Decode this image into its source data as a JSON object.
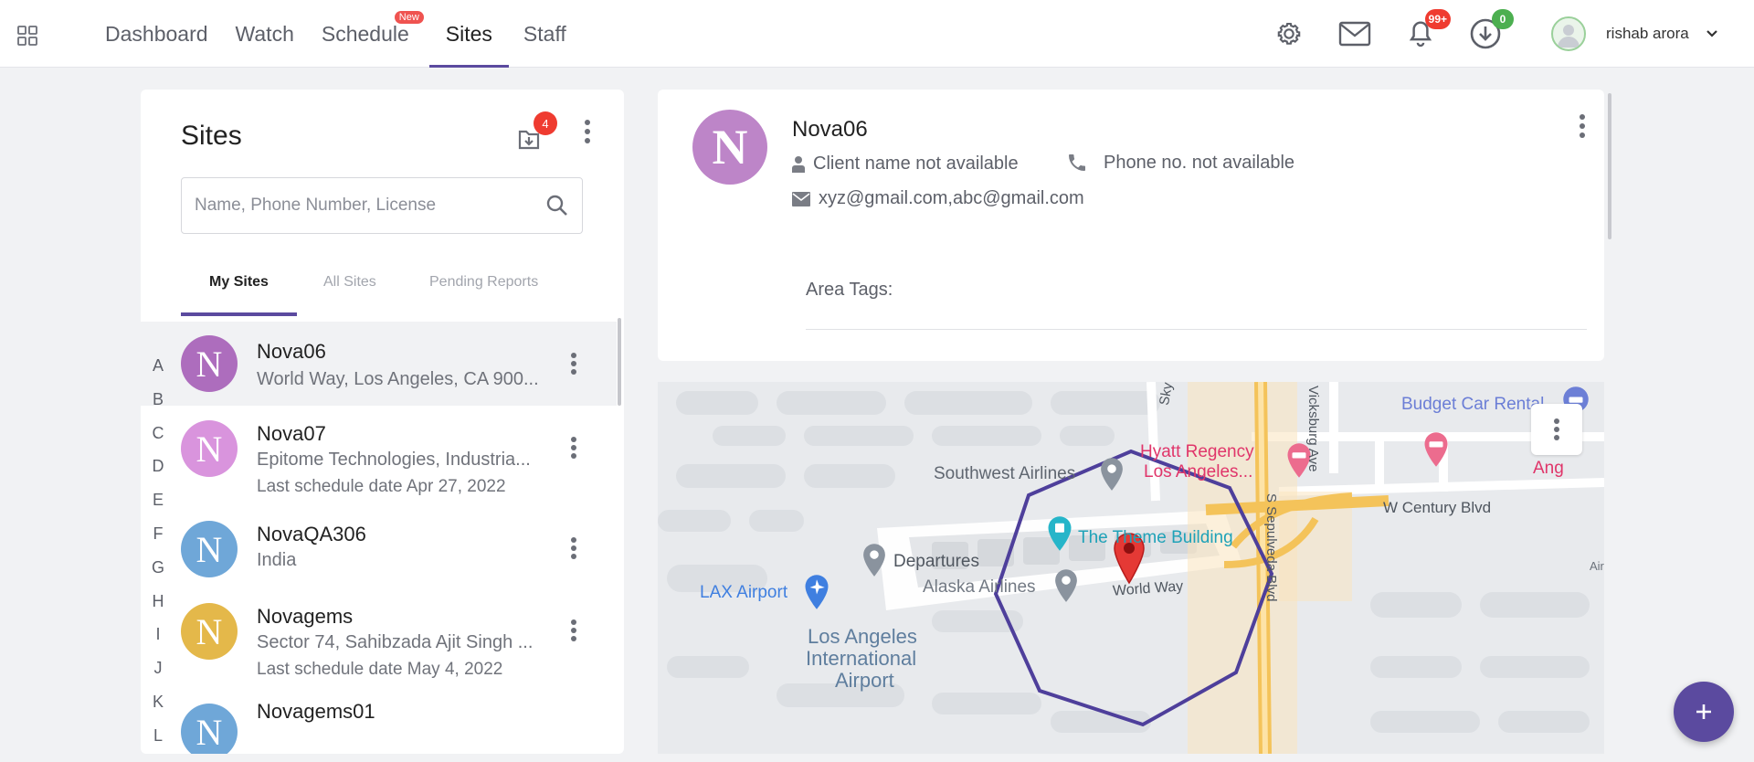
{
  "nav": {
    "tabs": [
      {
        "label": "Dashboard"
      },
      {
        "label": "Watch"
      },
      {
        "label": "Schedule",
        "badge": "New"
      },
      {
        "label": "Sites",
        "active": true
      },
      {
        "label": "Staff"
      }
    ],
    "icons": [
      "gear-icon",
      "mail-icon",
      "bell-icon",
      "download-icon"
    ],
    "notifications_count": "99+",
    "downloads_count": "0",
    "user_name": "rishab arora"
  },
  "sites_panel": {
    "title": "Sites",
    "import_count": "4",
    "search_placeholder": "Name, Phone Number, License",
    "tabs": [
      "My Sites",
      "All Sites",
      "Pending Reports"
    ],
    "active_tab": "My Sites",
    "alphabet": [
      "A",
      "B",
      "C",
      "D",
      "E",
      "F",
      "G",
      "H",
      "I",
      "J",
      "K",
      "L"
    ],
    "sites": [
      {
        "initial": "N",
        "name": "Nova06",
        "address": "World Way, Los Angeles, CA 900...",
        "last_schedule": "",
        "color": "#ad6dbd",
        "selected": true
      },
      {
        "initial": "N",
        "name": "Nova07",
        "address": "Epitome Technologies, Industria...",
        "last_schedule": "Last schedule date Apr 27, 2022",
        "color": "#d994dd",
        "selected": false
      },
      {
        "initial": "N",
        "name": "NovaQA306",
        "address": "India",
        "last_schedule": "",
        "color": "#6fa7d8",
        "selected": false
      },
      {
        "initial": "N",
        "name": "Novagems",
        "address": "Sector 74, Sahibzada Ajit Singh ...",
        "last_schedule": "Last schedule date May 4, 2022",
        "color": "#e4b84a",
        "selected": false
      },
      {
        "initial": "N",
        "name": "Novagems01",
        "address": "",
        "last_schedule": "",
        "color": "#6fa7d8",
        "selected": false
      }
    ]
  },
  "detail": {
    "initial": "N",
    "name": "Nova06",
    "client": "Client name not available",
    "phone": "Phone no. not available",
    "email": "xyz@gmail.com,abc@gmail.com",
    "area_tags_label": "Area Tags:"
  },
  "map": {
    "labels": {
      "budget": "Budget Car Rental",
      "hyatt_1": "Hyatt Regency",
      "hyatt_2": "Los Angeles...",
      "southwest": "Southwest Airlines",
      "theme": "The Theme Building",
      "departures": "Departures",
      "alaska": "Alaska Airlines",
      "world_way": "World Way",
      "lax": "LAX Airport",
      "lax_intl_1": "Los Angeles",
      "lax_intl_2": "International",
      "lax_intl_3": "Airport",
      "century": "W Century Blvd",
      "sky_way": "Sky Way",
      "vicksburg": "Vicksburg Ave",
      "sepulveda": "S Sepulveda Blvd",
      "ang": "Ang",
      "air": "Air"
    }
  },
  "colors": {
    "accent": "#5b4a9f",
    "badge_red": "#ef3b30",
    "badge_green": "#4caf50"
  }
}
